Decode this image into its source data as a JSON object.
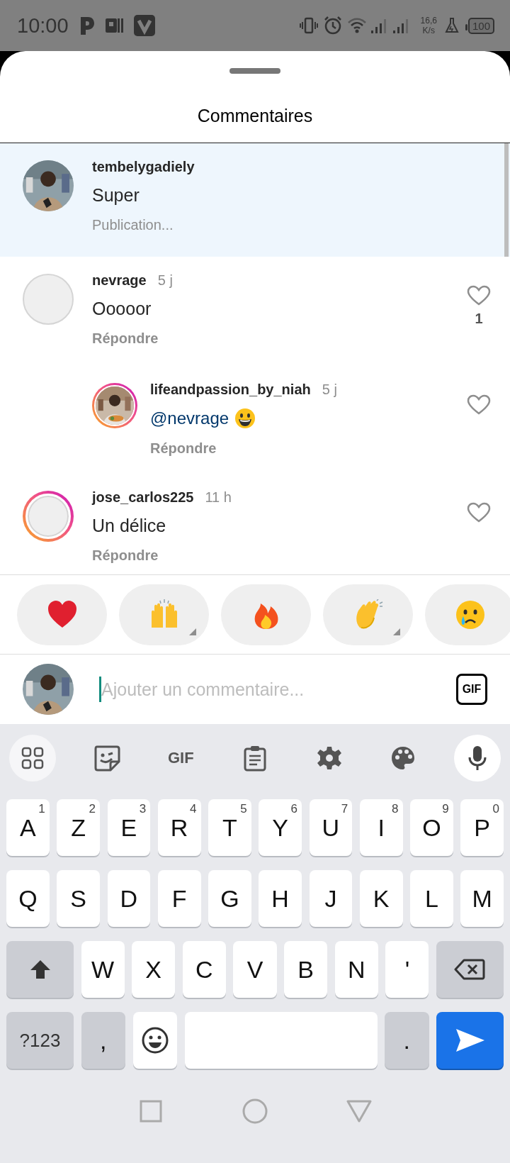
{
  "status_bar": {
    "time": "10:00",
    "network_speed": "16,6",
    "network_unit": "K/s",
    "battery": "100"
  },
  "sheet": {
    "title": "Commentaires"
  },
  "comments": [
    {
      "kind": "pending",
      "username": "tembelygadiely",
      "text": "Super",
      "action": "Publication...",
      "highlighted": true,
      "story_ring": false
    },
    {
      "kind": "posted",
      "username": "nevrage",
      "time": "5 j",
      "text": "Ooooor",
      "action": "Répondre",
      "highlighted": false,
      "avatar": {
        "kind": "empty"
      },
      "story_ring": false,
      "liked": false,
      "like_count": "1",
      "children": [
        {
          "kind": "posted",
          "username": "lifeandpassion_by_niah",
          "time": "5 j",
          "mention": "@nevrage",
          "emoji": {
            "kind": "grinning"
          },
          "action": "Répondre",
          "highlighted": false,
          "story_ring": true,
          "liked": false
        }
      ]
    },
    {
      "kind": "posted",
      "username": "jose_carlos225",
      "time": "11 h",
      "text": "Un délice",
      "action": "Répondre",
      "highlighted": false,
      "avatar": {
        "kind": "empty"
      },
      "story_ring": true,
      "liked": false
    }
  ],
  "reactions": [
    {
      "kind": "heart",
      "has_variants": false
    },
    {
      "kind": "raised_hands",
      "has_variants": true
    },
    {
      "kind": "fire",
      "has_variants": false
    },
    {
      "kind": "clapping_hands",
      "has_variants": true
    },
    {
      "kind": "crying_face",
      "has_variants": false
    }
  ],
  "composer": {
    "placeholder": "Ajouter un commentaire...",
    "gif_label": "GIF"
  },
  "keyboard": {
    "toolbar": [
      {
        "kind": "apps"
      },
      {
        "kind": "sticker"
      },
      {
        "kind": "gif",
        "label": "GIF"
      },
      {
        "kind": "clipboard"
      },
      {
        "kind": "settings"
      },
      {
        "kind": "palette"
      },
      {
        "kind": "mic"
      }
    ],
    "rows": [
      [
        {
          "kind": "letter",
          "label": "A",
          "hint": "1"
        },
        {
          "kind": "letter",
          "label": "Z",
          "hint": "2"
        },
        {
          "kind": "letter",
          "label": "E",
          "hint": "3"
        },
        {
          "kind": "letter",
          "label": "R",
          "hint": "4"
        },
        {
          "kind": "letter",
          "label": "T",
          "hint": "5"
        },
        {
          "kind": "letter",
          "label": "Y",
          "hint": "6"
        },
        {
          "kind": "letter",
          "label": "U",
          "hint": "7"
        },
        {
          "kind": "letter",
          "label": "I",
          "hint": "8"
        },
        {
          "kind": "letter",
          "label": "O",
          "hint": "9"
        },
        {
          "kind": "letter",
          "label": "P",
          "hint": "0"
        }
      ],
      [
        {
          "kind": "letter",
          "label": "Q"
        },
        {
          "kind": "letter",
          "label": "S"
        },
        {
          "kind": "letter",
          "label": "D"
        },
        {
          "kind": "letter",
          "label": "F"
        },
        {
          "kind": "letter",
          "label": "G"
        },
        {
          "kind": "letter",
          "label": "H"
        },
        {
          "kind": "letter",
          "label": "J"
        },
        {
          "kind": "letter",
          "label": "K"
        },
        {
          "kind": "letter",
          "label": "L"
        },
        {
          "kind": "letter",
          "label": "M"
        }
      ],
      [
        {
          "kind": "shift"
        },
        {
          "kind": "letter",
          "label": "W"
        },
        {
          "kind": "letter",
          "label": "X"
        },
        {
          "kind": "letter",
          "label": "C"
        },
        {
          "kind": "letter",
          "label": "V"
        },
        {
          "kind": "letter",
          "label": "B"
        },
        {
          "kind": "letter",
          "label": "N"
        },
        {
          "kind": "letter",
          "label": "'"
        },
        {
          "kind": "backspace"
        }
      ],
      [
        {
          "kind": "symbols",
          "label": "?123"
        },
        {
          "kind": "punct",
          "label": ","
        },
        {
          "kind": "emoji"
        },
        {
          "kind": "space"
        },
        {
          "kind": "punct",
          "label": "."
        },
        {
          "kind": "send"
        }
      ]
    ]
  },
  "nav_bar": [
    {
      "kind": "recents"
    },
    {
      "kind": "home"
    },
    {
      "kind": "back"
    }
  ]
}
